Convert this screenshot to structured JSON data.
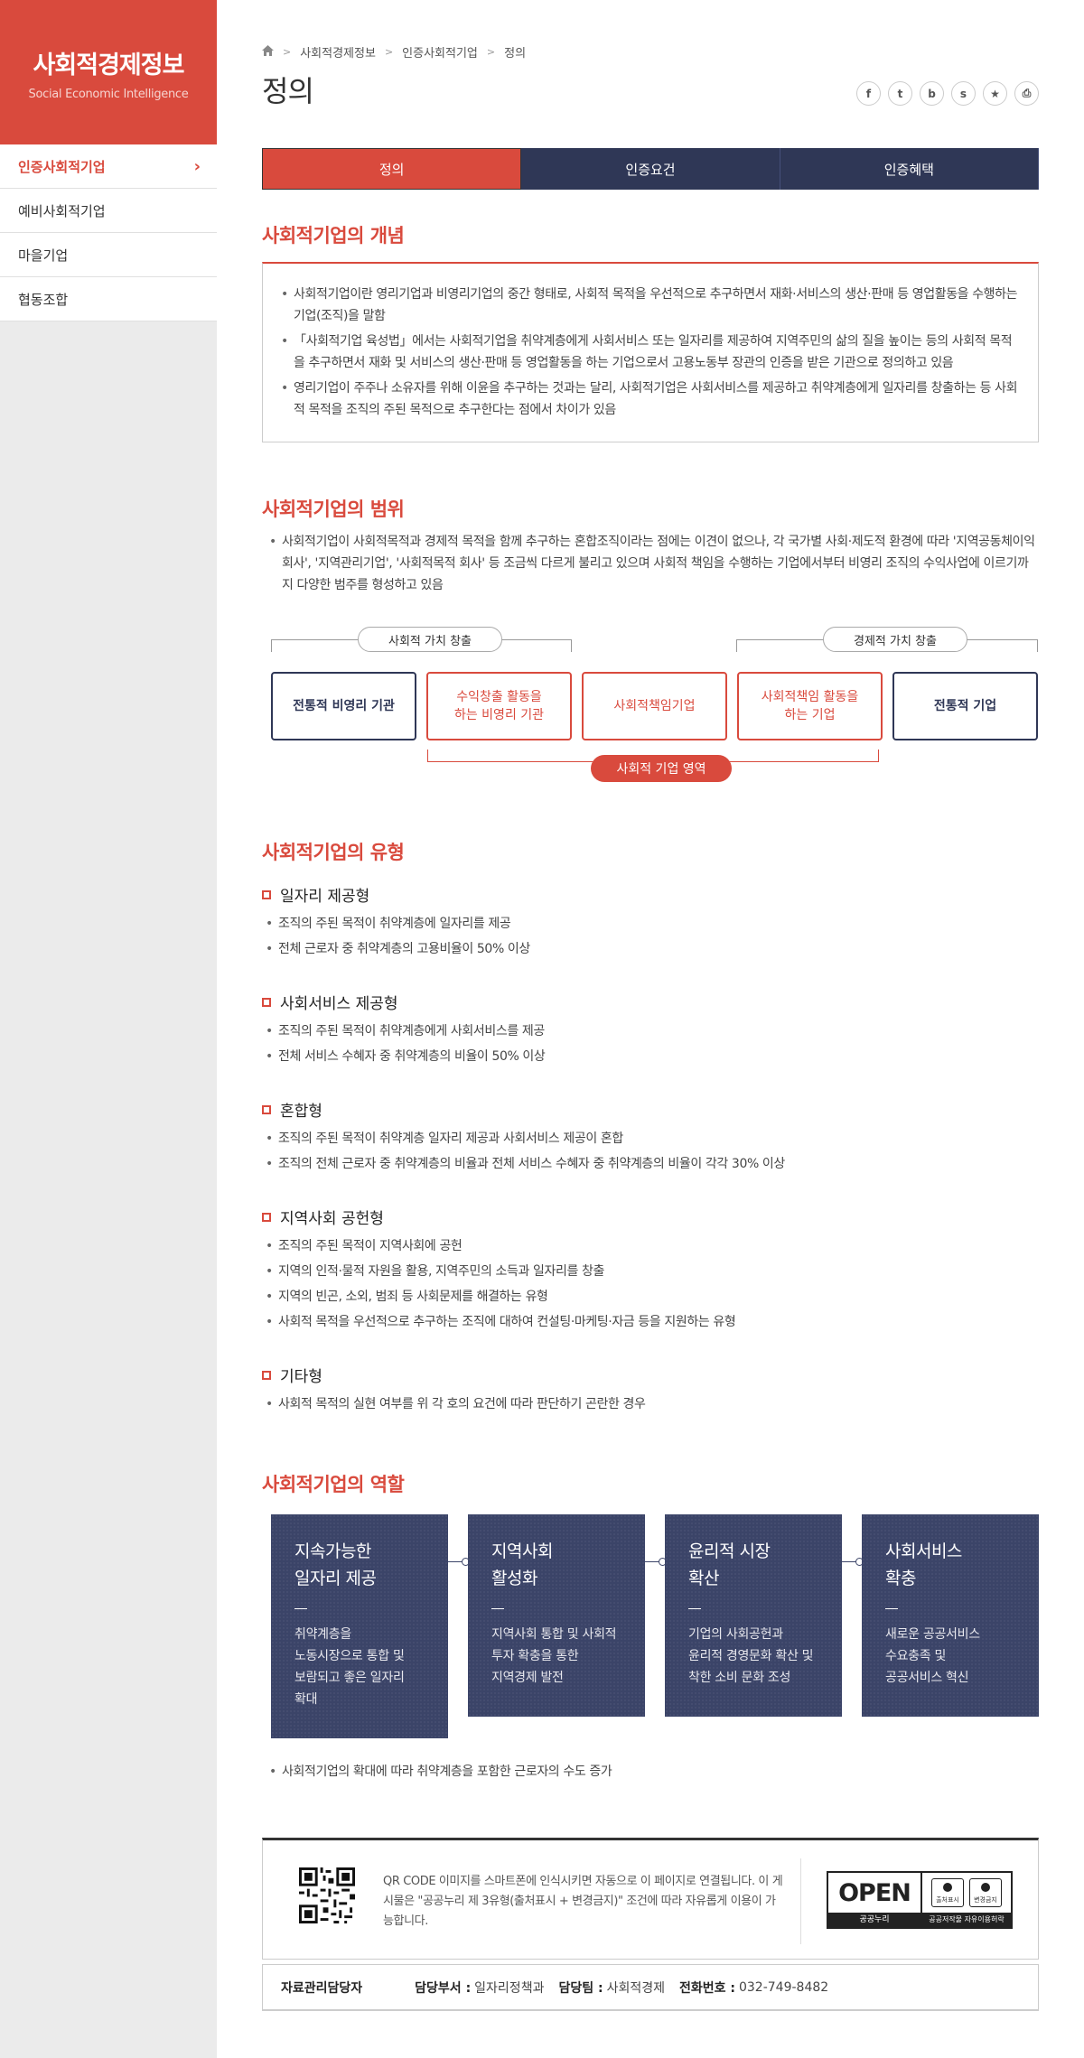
{
  "sidebar": {
    "brand_title": "사회적경제정보",
    "brand_subtitle": "Social Economic Intelligence",
    "items": [
      {
        "label": "인증사회적기업",
        "active": true
      },
      {
        "label": "예비사회적기업",
        "active": false
      },
      {
        "label": "마을기업",
        "active": false
      },
      {
        "label": "협동조합",
        "active": false
      }
    ]
  },
  "breadcrumb": {
    "home_icon": "home-icon",
    "items": [
      "사회적경제정보",
      "인증사회적기업",
      "정의"
    ]
  },
  "page_title": "정의",
  "share": {
    "facebook": "f",
    "twitter": "t",
    "blog": "b",
    "story": "s",
    "bookmark": "★",
    "print": "⎙"
  },
  "tabs": [
    {
      "label": "정의",
      "active": true
    },
    {
      "label": "인증요건",
      "active": false
    },
    {
      "label": "인증혜택",
      "active": false
    }
  ],
  "concept": {
    "title": "사회적기업의 개념",
    "items": [
      "사회적기업이란 영리기업과 비영리기업의 중간 형태로, 사회적 목적을 우선적으로 추구하면서 재화·서비스의 생산·판매 등 영업활동을 수행하는 기업(조직)을 말함",
      "「사회적기업 육성법」에서는 사회적기업을 취약계층에게 사회서비스 또는 일자리를 제공하여 지역주민의 삶의 질을 높이는 등의 사회적 목적을 추구하면서 재화 및 서비스의 생산·판매 등 영업활동을 하는 기업으로서 고용노동부 장관의 인증을 받은 기관으로 정의하고 있음",
      "영리기업이 주주나 소유자를 위해 이윤을 추구하는 것과는 달리, 사회적기업은 사회서비스를 제공하고 취약계층에게 일자리를 창출하는 등 사회적 목적을 조직의 주된 목적으로 추구한다는 점에서 차이가 있음"
    ]
  },
  "scope": {
    "title": "사회적기업의 범위",
    "text": "사회적기업이 사회적목적과 경제적 목적을 함께 추구하는 혼합조직이라는 점에는 이견이 없으나, 각 국가별 사회·제도적 환경에 따라 '지역공동체이익회사', '지역관리기업', '사회적목적 회사' 등 조금씩 다르게 불리고 있으며 사회적 책임을 수행하는 기업에서부터 비영리 조직의 수익사업에 이르기까지 다양한 범주를 형성하고 있음",
    "social_value": "사회적 가치 창출",
    "economic_value": "경제적 가치 창출",
    "boxes": [
      {
        "label": "전통적 비영리 기관",
        "style": "navy"
      },
      {
        "label": "수익창출 활동을\n하는 비영리 기관",
        "style": "red"
      },
      {
        "label": "사회적책임기업",
        "style": "red"
      },
      {
        "label": "사회적책임 활동을\n하는 기업",
        "style": "red"
      },
      {
        "label": "전통적 기업",
        "style": "navy"
      }
    ],
    "area_label": "사회적 기업 영역"
  },
  "types": {
    "title": "사회적기업의 유형",
    "groups": [
      {
        "heading": "일자리 제공형",
        "items": [
          "조직의 주된 목적이 취약계층에 일자리를 제공",
          "전체 근로자 중 취약계층의 고용비율이 50% 이상"
        ]
      },
      {
        "heading": "사회서비스 제공형",
        "items": [
          "조직의 주된 목적이 취약계층에게 사회서비스를 제공",
          "전체 서비스 수혜자 중 취약계층의 비율이 50% 이상"
        ]
      },
      {
        "heading": "혼합형",
        "items": [
          "조직의 주된 목적이 취약계층 일자리 제공과 사회서비스 제공이 혼합",
          "조직의 전체 근로자 중 취약계층의 비율과 전체 서비스 수혜자 중 취약계층의 비율이 각각 30% 이상"
        ]
      },
      {
        "heading": "지역사회 공헌형",
        "items": [
          "조직의 주된 목적이 지역사회에 공헌",
          "지역의 인적·물적 자원을 활용, 지역주민의 소득과 일자리를 창출",
          "지역의 빈곤, 소외, 범죄 등 사회문제를 해결하는 유형",
          "사회적 목적을 우선적으로 추구하는 조직에 대하여 컨설팅·마케팅·자금 등을 지원하는 유형"
        ]
      },
      {
        "heading": "기타형",
        "items": [
          "사회적 목적의 실현 여부를 위 각 호의 요건에 따라 판단하기 곤란한 경우"
        ]
      }
    ]
  },
  "roles": {
    "title": "사회적기업의 역할",
    "cards": [
      {
        "title": "지속가능한\n일자리 제공",
        "desc": "취약계층을\n노동시장으로 통합 및\n보람되고 좋은 일자리\n확대"
      },
      {
        "title": "지역사회\n활성화",
        "desc": "지역사회 통합 및 사회적\n투자 확충을 통한\n지역경제 발전"
      },
      {
        "title": "윤리적 시장\n확산",
        "desc": "기업의 사회공헌과\n윤리적 경영문화 확산 및\n착한 소비 문화 조성"
      },
      {
        "title": "사회서비스\n확충",
        "desc": "새로운 공공서비스\n수요충족 및\n공공서비스 혁신"
      }
    ],
    "dash": "—",
    "note": "사회적기업의 확대에 따라 취약계층을 포함한 근로자의 수도 증가"
  },
  "qr": {
    "icon": "qr-code-icon",
    "text": "QR CODE 이미지를 스마트폰에 인식시키면 자동으로 이 페이지로 연결됩니다. 이 게시물은 \"공공누리 제 3유형(출처표시 + 변경금지)\" 조건에 따라 자유롭게 이용이 가능합니다.",
    "open_word": "OPEN",
    "open_sub": "공공누리",
    "open_sub2": "공공저작물 자유이용허락",
    "license_1": "출처표시",
    "license_2": "변경금지"
  },
  "manager": {
    "label": "자료관리담당자",
    "dept_label": "담당부서 :",
    "dept": "일자리정책과",
    "team_label": "담당팀 :",
    "team": "사회적경제",
    "phone_label": "전화번호 :",
    "phone": "032-749-8482"
  }
}
